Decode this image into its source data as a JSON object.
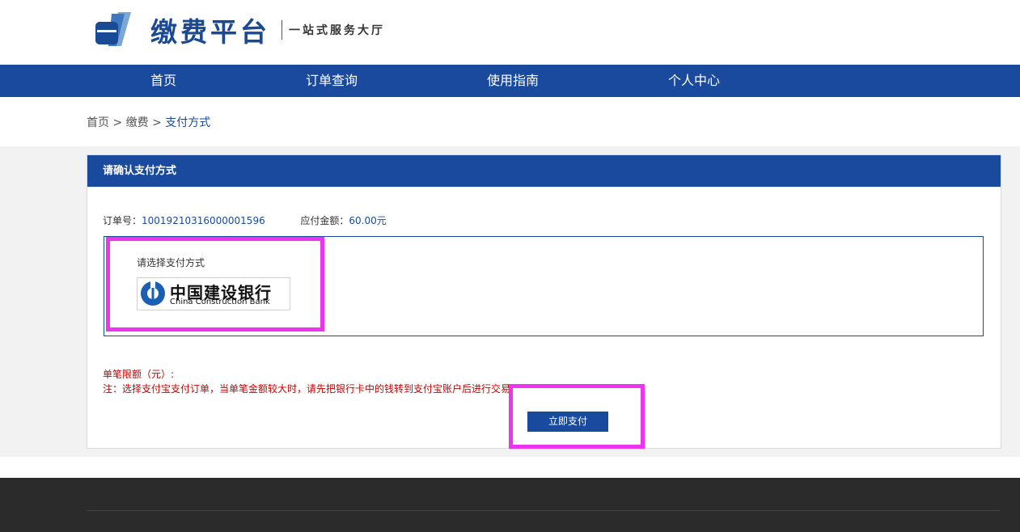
{
  "header": {
    "title": "缴费平台",
    "slogan": "一站式服务大厅"
  },
  "nav": {
    "items": [
      "首页",
      "订单查询",
      "使用指南",
      "个人中心"
    ]
  },
  "breadcrumb": {
    "home": "首页",
    "sep1": " > ",
    "pay": "缴费",
    "sep2": " > ",
    "current": "支付方式"
  },
  "panel": {
    "title": "请确认支付方式",
    "order_label": "订单号：",
    "order_number": "10019210316000001596",
    "amount_label": "应付金额：",
    "amount_value": "60.00元",
    "choose_label": "请选择支付方式",
    "bank_name_cn": "中国建设银行",
    "bank_name_en": "China Construction Bank",
    "limit_text": "单笔限额（元）:",
    "note_text": "注：选择支付宝支付订单，当单笔金额较大时，请先把银行卡中的钱转到支付宝账户后进行交易",
    "pay_button": "立即支付"
  },
  "colors": {
    "brand_blue": "#1a4a9e",
    "highlight": "#ee33ee",
    "warning_red": "#cc0000"
  }
}
